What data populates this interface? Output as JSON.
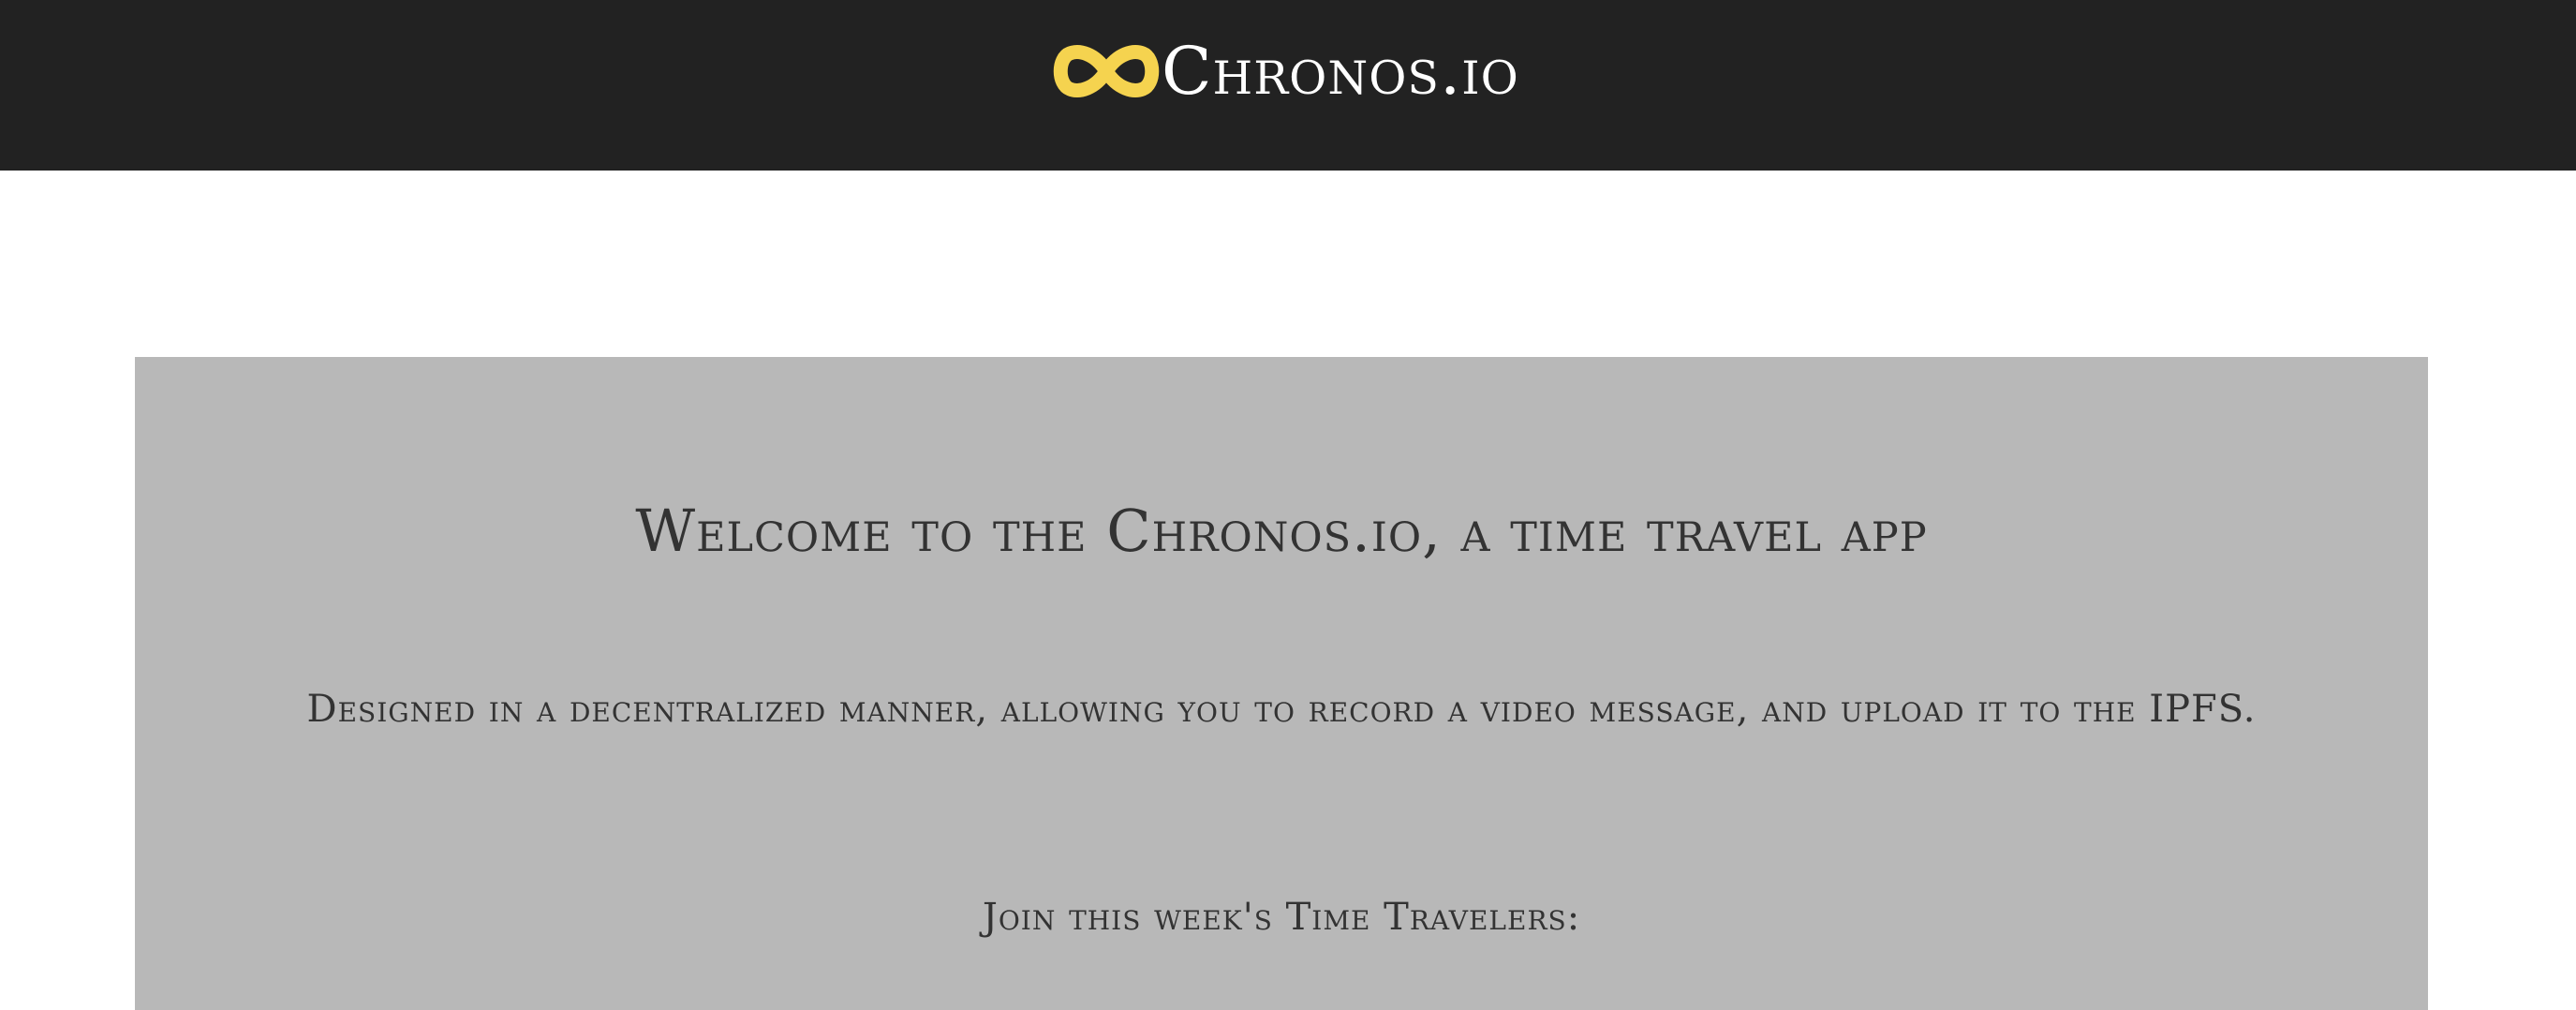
{
  "navbar": {
    "brand": {
      "name": "Chronos.io",
      "logo_icon": "infinity-icon",
      "logo_color": "#f5d34f"
    },
    "background": "#222222"
  },
  "hero": {
    "background": "#b8b8b8",
    "title": "Welcome to the Chronos.io, a time travel app",
    "description": "Designed in a decentralized manner, allowing you to record a video message, and upload it to the IPFS.",
    "join_label": "Join this week's Time Travelers:"
  }
}
